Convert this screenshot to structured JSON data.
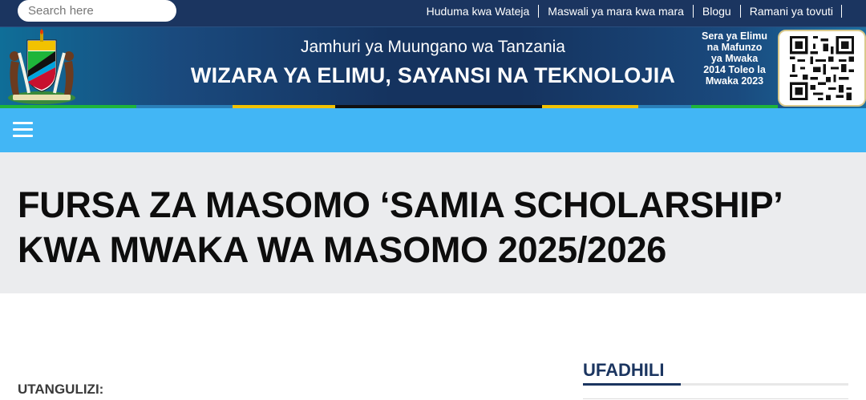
{
  "topbar": {
    "search_placeholder": "Search here",
    "links": [
      {
        "label": "Huduma kwa Wateja"
      },
      {
        "label": "Maswali ya mara kwa mara"
      },
      {
        "label": "Blogu"
      },
      {
        "label": "Ramani ya tovuti"
      }
    ]
  },
  "banner": {
    "subtitle": "Jamhuri ya Muungano wa Tanzania",
    "title": "WIZARA YA ELIMU, SAYANSI NA TEKNOLOJIA",
    "sera_lines": [
      "Sera ya Elimu",
      "na Mafunzo",
      "ya Mwaka",
      "2014 Toleo la",
      "Mwaka 2023"
    ],
    "crest_icon": "tanzania-coat-of-arms",
    "qr_icon": "qr-code"
  },
  "navbar": {
    "menu_icon": "hamburger-menu-icon",
    "color": "#42b6f5"
  },
  "page": {
    "title": "FURSA ZA MASOMO ‘SAMIA SCHOLARSHIP’ KWA MWAKA WA MASOMO 2025/2026",
    "intro_label": "UTANGULIZI:"
  },
  "sidebar": {
    "heading": "UFADHILI"
  },
  "colors": {
    "topbar": "#1b3560",
    "title_band": "#ebecee",
    "accent": "#1b3560"
  }
}
